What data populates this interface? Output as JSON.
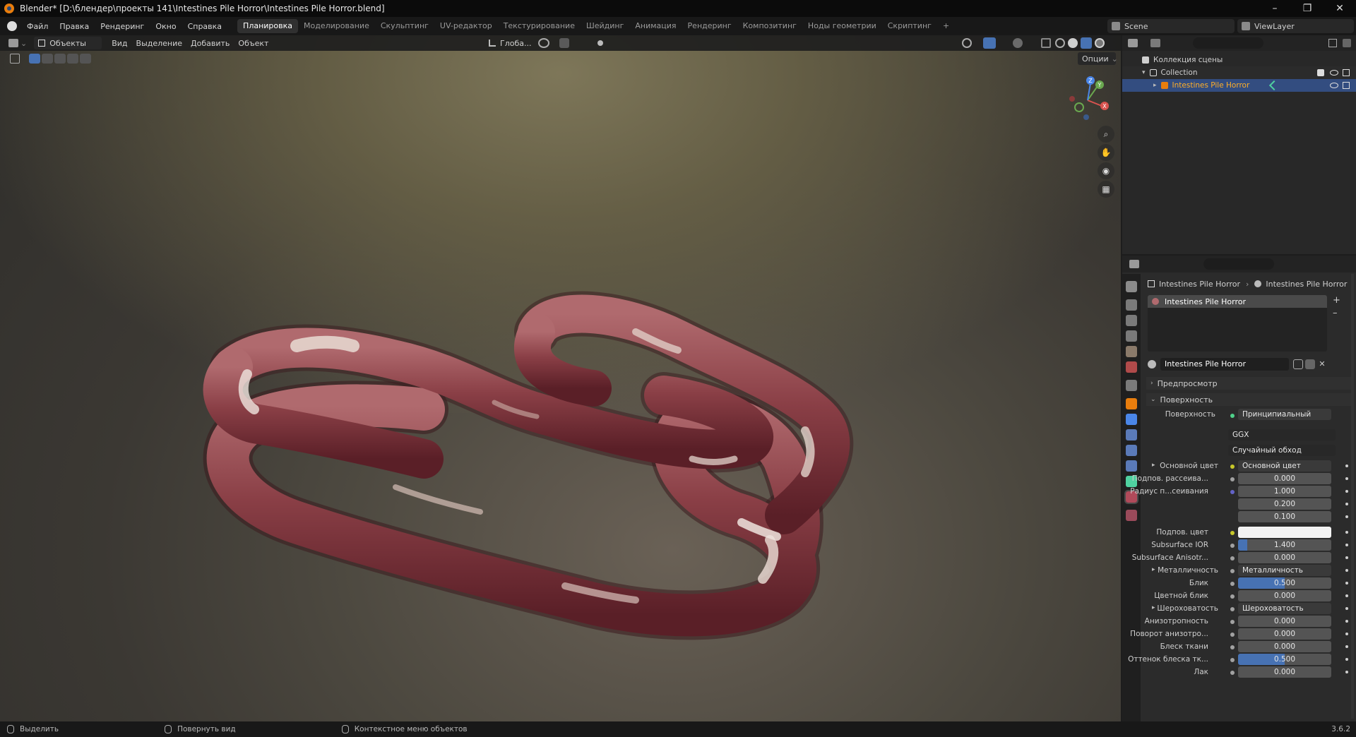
{
  "title_bar": {
    "text": "Blender* [D:\\блендер\\проекты 141\\Intestines Pile Horror\\Intestines Pile Horror.blend]",
    "minimize": "–",
    "restore": "❐",
    "close": "✕"
  },
  "menu": [
    "Файл",
    "Правка",
    "Рендеринг",
    "Окно",
    "Справка"
  ],
  "workspace_tabs": [
    {
      "label": "Планировка",
      "active": true
    },
    {
      "label": "Моделирование"
    },
    {
      "label": "Скульптинг"
    },
    {
      "label": "UV-редактор"
    },
    {
      "label": "Текстурирование"
    },
    {
      "label": "Шейдинг"
    },
    {
      "label": "Анимация"
    },
    {
      "label": "Рендеринг"
    },
    {
      "label": "Композитинг"
    },
    {
      "label": "Ноды геометрии"
    },
    {
      "label": "Скриптинг"
    }
  ],
  "add_workspace": "+",
  "scene": {
    "label": "Scene",
    "view_layer": "ViewLayer"
  },
  "viewport": {
    "mode": "Объекты",
    "menus": [
      "Вид",
      "Выделение",
      "Добавить",
      "Объект"
    ],
    "transform_orientation": "Глоба...",
    "options": "Опции",
    "gizmo": {
      "x": "X",
      "y": "Y",
      "z": "Z"
    }
  },
  "outliner": {
    "root": "Коллекция сцены",
    "collection": "Collection",
    "object": "Intestines Pile Horror"
  },
  "properties": {
    "breadcrumb_object": "Intestines Pile Horror",
    "breadcrumb_material": "Intestines Pile Horror",
    "slot_name": "Intestines Pile Horror",
    "material_name": "Intestines Pile Horror",
    "panel_preview": "Предпросмотр",
    "panel_surface": "Поверхность",
    "surface_label": "Поверхность",
    "surface_value": "Принципиальный BSDF",
    "distribution": "GGX",
    "subsurface_method": "Случайный обход",
    "fields": [
      {
        "label": "Основной цвет",
        "value": "Основной цвет",
        "kind": "link",
        "dot": "#c7c729",
        "expand": true
      },
      {
        "label": "Подпов. рассеива...",
        "value": "0.000",
        "kind": "num",
        "dot": "#a1a1a1"
      },
      {
        "label": "Радиус п...сеивания",
        "value": "1.000",
        "kind": "num",
        "dot": "#6363c7"
      },
      {
        "label": "",
        "value": "0.200",
        "kind": "num"
      },
      {
        "label": "",
        "value": "0.100",
        "kind": "num"
      },
      {
        "label": "Подпов. цвет",
        "value": "",
        "kind": "color",
        "dot": "#c7c729"
      },
      {
        "label": "Subsurface IOR",
        "value": "1.400",
        "kind": "num",
        "dot": "#a1a1a1",
        "fill": 0.1
      },
      {
        "label": "Subsurface Anisotr...",
        "value": "0.000",
        "kind": "num",
        "dot": "#a1a1a1"
      },
      {
        "label": "Металличность",
        "value": "Металличность",
        "kind": "link",
        "dot": "#a1a1a1",
        "expand": true
      },
      {
        "label": "Блик",
        "value": "0.500",
        "kind": "num",
        "dot": "#a1a1a1",
        "fill": 0.5
      },
      {
        "label": "Цветной блик",
        "value": "0.000",
        "kind": "num",
        "dot": "#a1a1a1"
      },
      {
        "label": "Шероховатость",
        "value": "Шероховатость",
        "kind": "link",
        "dot": "#a1a1a1",
        "expand": true
      },
      {
        "label": "Анизотропность",
        "value": "0.000",
        "kind": "num",
        "dot": "#a1a1a1"
      },
      {
        "label": "Поворот анизотро...",
        "value": "0.000",
        "kind": "num",
        "dot": "#a1a1a1"
      },
      {
        "label": "Блеск ткани",
        "value": "0.000",
        "kind": "num",
        "dot": "#a1a1a1"
      },
      {
        "label": "Оттенок блеска тк...",
        "value": "0.500",
        "kind": "num",
        "dot": "#a1a1a1",
        "fill": 0.5
      },
      {
        "label": "Лак",
        "value": "0.000",
        "kind": "num",
        "dot": "#a1a1a1"
      }
    ]
  },
  "status": {
    "select": "Выделить",
    "rotate": "Повернуть вид",
    "context": "Контекстное меню объектов",
    "version": "3.6.2"
  },
  "colors": {
    "accent": "#4772b3",
    "active_tab": "#303030",
    "selection": "#334d80",
    "object_orange": "#e87d0d"
  }
}
